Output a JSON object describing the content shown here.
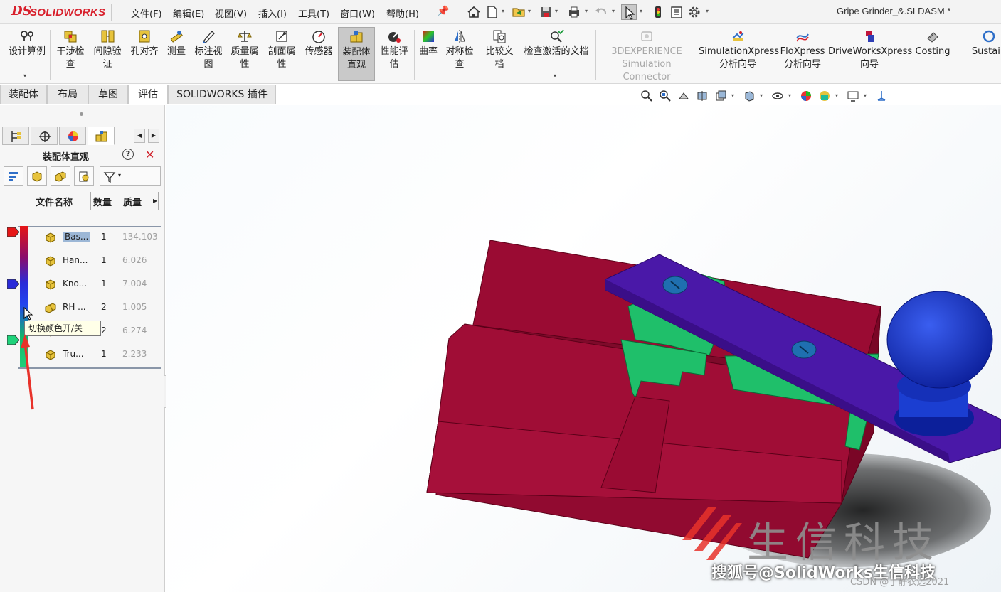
{
  "app": {
    "logo_ds": "DS",
    "logo_name": "SOLIDWORKS",
    "document_title": "Gripe Grinder_&.SLDASM *"
  },
  "menu": [
    "文件(F)",
    "编辑(E)",
    "视图(V)",
    "插入(I)",
    "工具(T)",
    "窗口(W)",
    "帮助(H)"
  ],
  "commands": {
    "design_study": "设计算例",
    "interference_1": "干涉检",
    "interference_2": "查",
    "clearance_1": "间隙验",
    "clearance_2": "证",
    "hole_align": "孔对齐",
    "measure": "测量",
    "markup_1": "标注视",
    "markup_2": "图",
    "mass_1": "质量属",
    "mass_2": "性",
    "section_1": "剖面属",
    "section_2": "性",
    "sensor": "传感器",
    "asm_vis_1": "装配体",
    "asm_vis_2": "直观",
    "perf_1": "性能评",
    "perf_2": "估",
    "curvature": "曲率",
    "symmetry_1": "对称检",
    "symmetry_2": "查",
    "compare_1": "比较文",
    "compare_2": "档",
    "check_active": "检查激活的文档",
    "threedx_1": "3DEXPERIENCE",
    "threedx_2": "Simulation Connector",
    "simx_1": "SimulationXpress",
    "simx_2": "分析向导",
    "flox_1": "FloXpress",
    "flox_2": "分析向导",
    "dwx_1": "DriveWorksXpress",
    "dwx_2": "向导",
    "costing": "Costing",
    "sustain": "Sustain"
  },
  "tabs": [
    "装配体",
    "布局",
    "草图",
    "评估",
    "SOLIDWORKS 插件"
  ],
  "active_tab": "评估",
  "panel": {
    "title": "装配体直观",
    "help": "?",
    "close": "✕",
    "columns": {
      "name": "文件名称",
      "qty": "数量",
      "mass": "质量"
    },
    "rows": [
      {
        "name": "Bas...",
        "qty": "1",
        "mass": "134.103",
        "selected": true
      },
      {
        "name": "Han...",
        "qty": "1",
        "mass": "6.026"
      },
      {
        "name": "Kno...",
        "qty": "1",
        "mass": "7.004"
      },
      {
        "name": "RH ...",
        "qty": "2",
        "mass": "1.005"
      },
      {
        "name": "",
        "qty": "2",
        "mass": "6.274"
      },
      {
        "name": "Tru...",
        "qty": "1",
        "mass": "2.233"
      }
    ],
    "tooltip": "切换颜色开/关",
    "colors": {
      "high": "#e51616",
      "mid": "#2a2bd8",
      "low": "#1fd27a"
    }
  },
  "watermark": {
    "brand": "生信科技",
    "caption": "搜狐号@SolidWorks生信科技",
    "csdn": "CSDN @于静衣远2021"
  },
  "model_colors": {
    "base": "#9a0b33",
    "handle": "#4a18a8",
    "knob": "#1b3ed1",
    "slide": "#1fbf6a"
  }
}
